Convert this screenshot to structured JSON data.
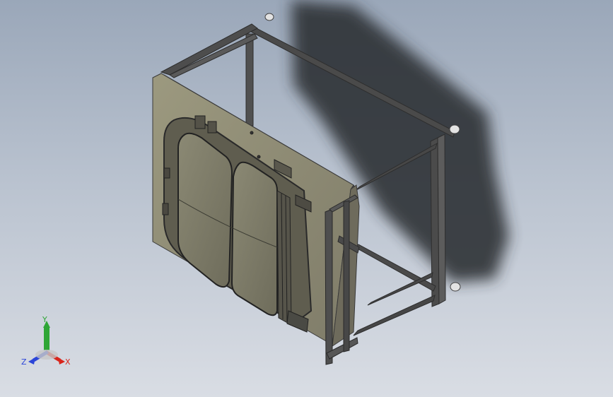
{
  "viewport": {
    "background_top": "#9aa7b9",
    "background_bottom": "#d9dde4"
  },
  "model": {
    "frame_color": "#3b3b3b",
    "panel_color": "#8f8c79",
    "shadow_color": "#2b2d31"
  },
  "triad": {
    "x_label": "X",
    "y_label": "Y",
    "z_label": "Z",
    "x_color": "#d8261c",
    "y_color": "#2ea636",
    "z_color": "#2b45d8"
  }
}
